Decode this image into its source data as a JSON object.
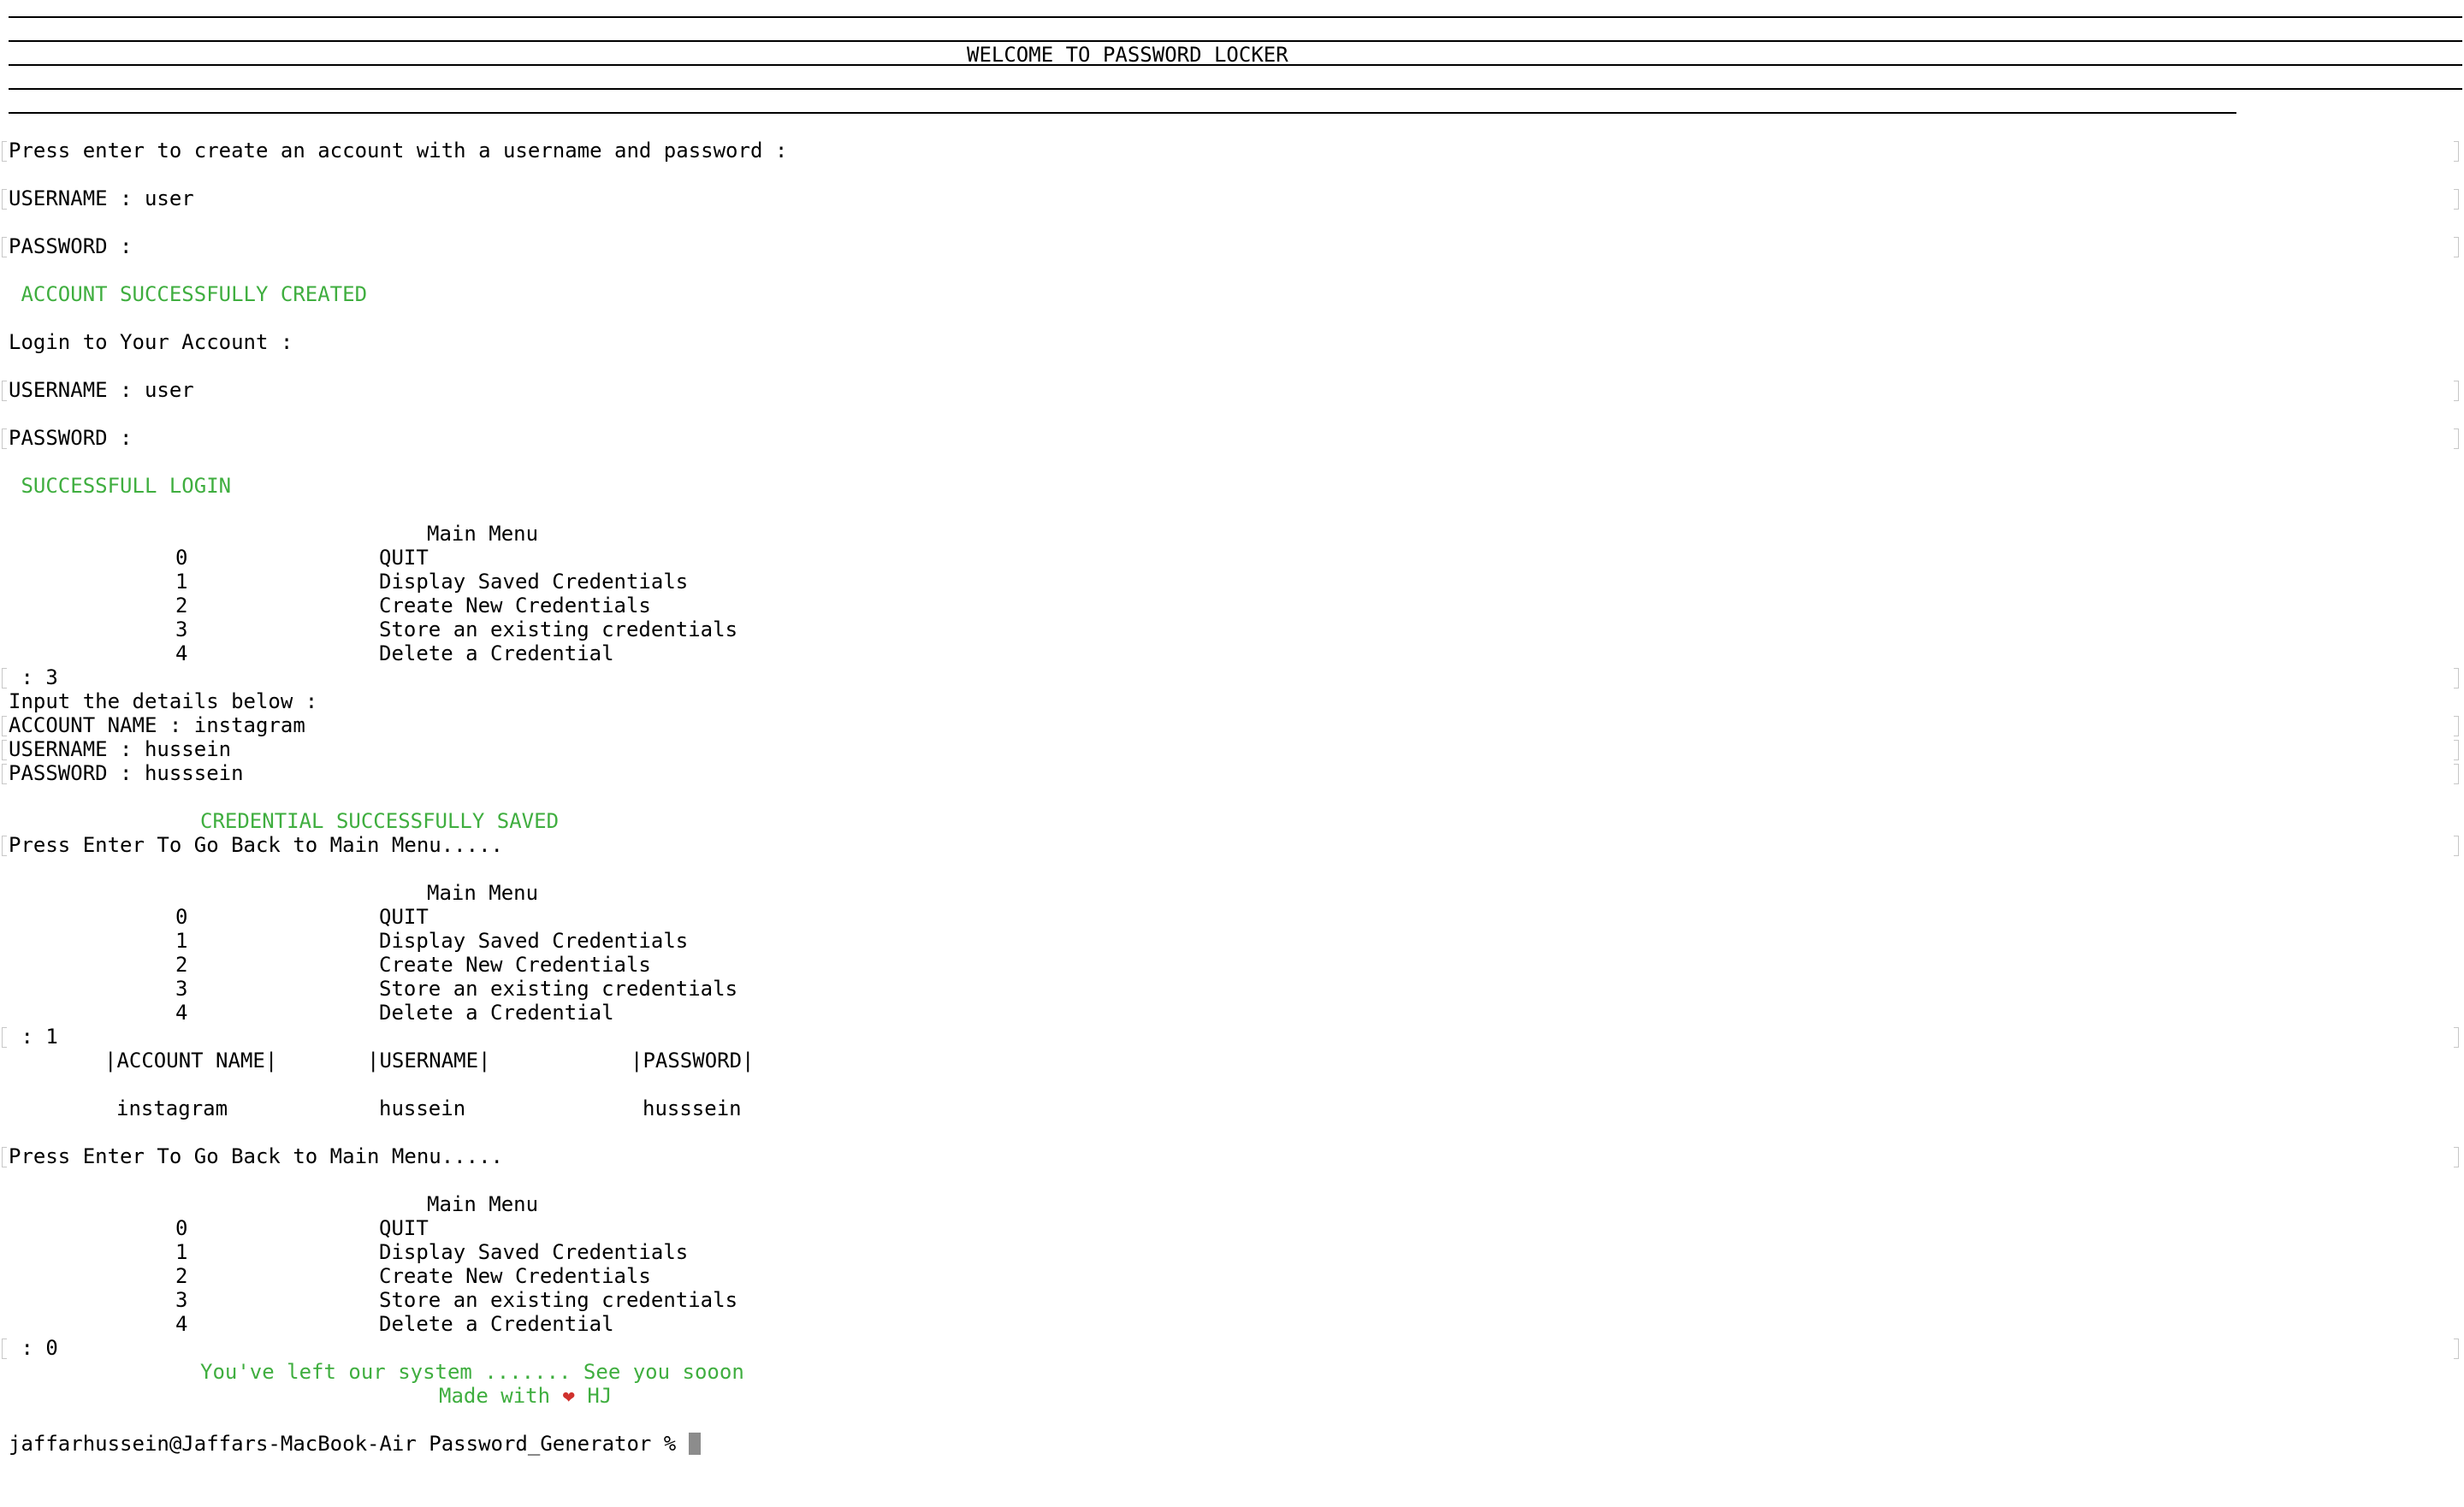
{
  "banner": {
    "title": "WELCOME TO PASSWORD LOCKER"
  },
  "signup": {
    "prompt": "Press enter to create an account with a username and password :",
    "username": "USERNAME : user",
    "password": "PASSWORD :",
    "success": " ACCOUNT SUCCESSFULLY CREATED"
  },
  "login": {
    "title": "Login to Your Account :",
    "username": "USERNAME : user",
    "password": "PASSWORD :",
    "success": " SUCCESSFULL LOGIN"
  },
  "menu": {
    "title": "Main Menu",
    "items": [
      {
        "num": "0",
        "label": "QUIT"
      },
      {
        "num": "1",
        "label": "Display Saved Credentials"
      },
      {
        "num": "2",
        "label": "Create New Credentials"
      },
      {
        "num": "3",
        "label": "Store an existing credentials"
      },
      {
        "num": "4",
        "label": "Delete a Credential"
      }
    ]
  },
  "store": {
    "choice": " : 3",
    "details_prompt": "Input the details below :",
    "account": "ACCOUNT NAME : instagram",
    "username": "USERNAME : hussein",
    "password": "PASSWORD : husssein",
    "saved": "CREDENTIAL SUCCESSFULLY SAVED",
    "back": "Press Enter To Go Back to Main Menu....."
  },
  "display": {
    "choice": " : 1",
    "headers": [
      "|ACCOUNT NAME|",
      "|USERNAME|",
      "|PASSWORD|"
    ],
    "row": [
      "instagram",
      "hussein",
      "husssein"
    ],
    "back": "Press Enter To Go Back to Main Menu....."
  },
  "quit": {
    "choice": " : 0",
    "goodbye": "You've left our system ....... See you sooon",
    "made_with": "Made with",
    "initials": "HJ",
    "heart_icon": "heart-icon"
  },
  "shell": {
    "prompt": "jaffarhussein@Jaffars-MacBook-Air Password_Generator % "
  }
}
